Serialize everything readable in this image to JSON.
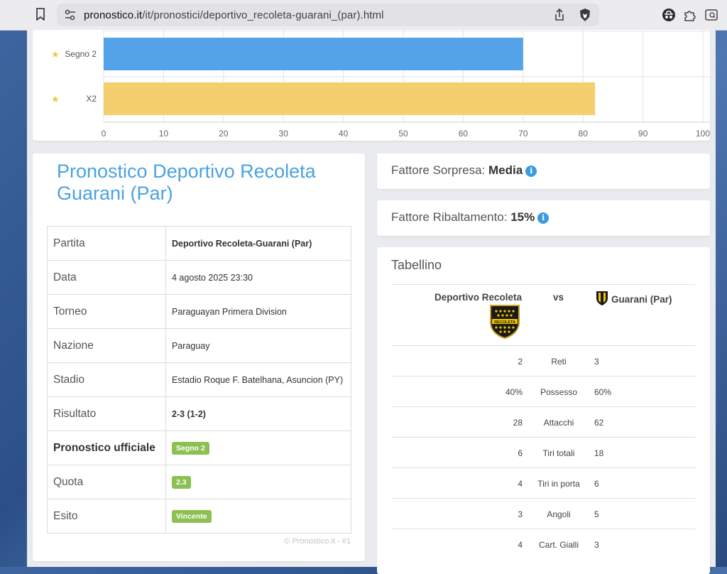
{
  "browser": {
    "url_host": "pronostico.it",
    "url_path": "/it/pronostici/deportivo_recoleta-guarani_(par).html"
  },
  "chart_data": {
    "type": "bar",
    "orientation": "horizontal",
    "categories": [
      "Segno 2",
      "X2"
    ],
    "values": [
      70,
      82
    ],
    "colors": [
      "#54a3e8",
      "#f5cf6e"
    ],
    "xlim": [
      0,
      100
    ],
    "xticks": [
      0,
      10,
      20,
      30,
      40,
      50,
      60,
      70,
      80,
      90,
      100
    ],
    "grid": true,
    "title": "",
    "xlabel": "",
    "ylabel": ""
  },
  "prediction": {
    "title": "Pronostico Deportivo Recoleta Guarani (Par)",
    "rows": [
      {
        "key": "Partita",
        "value": "Deportivo Recoleta-Guarani (Par)",
        "type": "bold"
      },
      {
        "key": "Data",
        "value": "4 agosto 2025 23:30",
        "type": "text"
      },
      {
        "key": "Torneo",
        "value": "Paraguayan Primera Division",
        "type": "text"
      },
      {
        "key": "Nazione",
        "value": "Paraguay",
        "type": "text"
      },
      {
        "key": "Stadio",
        "value": "Estadio Roque F. Batelhana, Asuncion (PY)",
        "type": "text"
      },
      {
        "key": "Risultato",
        "value": "2-3 (1-2)",
        "type": "bold"
      },
      {
        "key": "Pronostico ufficiale",
        "value": "Segno 2",
        "type": "badge",
        "key_bold": true
      },
      {
        "key": "Quota",
        "value": "2.3",
        "type": "badge"
      },
      {
        "key": "Esito",
        "value": "Vincente",
        "type": "badge"
      }
    ],
    "copyright": "© Pronostico.it - #1"
  },
  "fattore_sorpresa": {
    "label": "Fattore Sorpresa:",
    "value": "Media"
  },
  "fattore_ribaltamento": {
    "label": "Fattore Ribaltamento:",
    "value": "15%"
  },
  "tabellino": {
    "title": "Tabellino",
    "home": "Deportivo Recoleta",
    "vs": "vs",
    "away": "Guarani (Par)",
    "crest_text": "RECOLETA",
    "stats": [
      {
        "home": "2",
        "name": "Reti",
        "away": "3"
      },
      {
        "home": "40%",
        "name": "Possesso",
        "away": "60%"
      },
      {
        "home": "28",
        "name": "Attacchi",
        "away": "62"
      },
      {
        "home": "6",
        "name": "Tiri totali",
        "away": "18"
      },
      {
        "home": "4",
        "name": "Tiri in porta",
        "away": "6"
      },
      {
        "home": "3",
        "name": "Angoli",
        "away": "5"
      },
      {
        "home": "4",
        "name": "Cart. Gialli",
        "away": "3"
      }
    ]
  }
}
